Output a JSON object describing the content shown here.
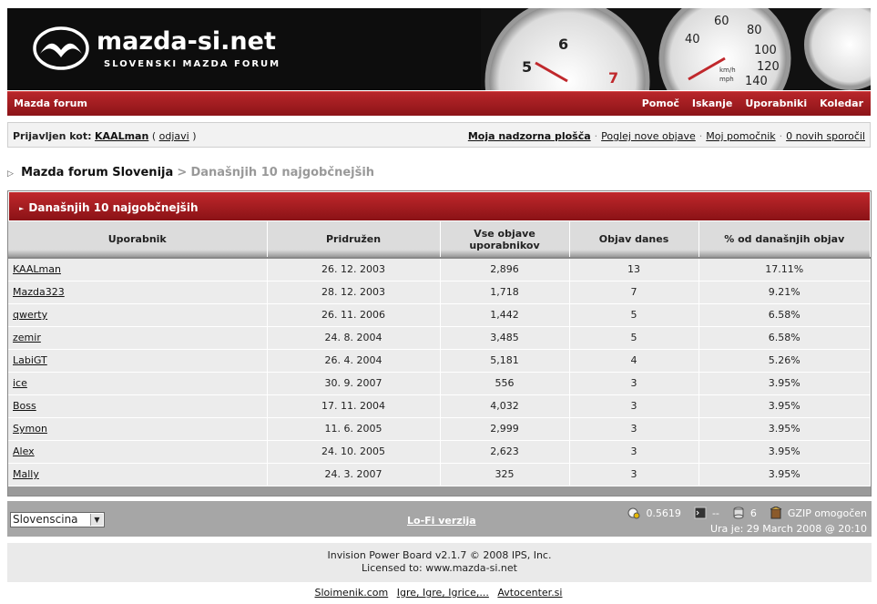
{
  "header": {
    "logo_text": "mazda-si.net",
    "logo_subtitle": "SLOVENSKI MAZDA FORUM",
    "logo_icon": "mazda-emblem-icon",
    "gauge_labels": [
      "5",
      "6",
      "7",
      "40",
      "60",
      "80",
      "100",
      "120",
      "140",
      "km/h",
      "mph"
    ]
  },
  "navbar": {
    "brand": "Mazda forum",
    "links": [
      "Pomoč",
      "Iskanje",
      "Uporabniki",
      "Koledar"
    ]
  },
  "userbar": {
    "logged_as_label": "Prijavljen kot:",
    "username": "KAALman",
    "logout_open": "(",
    "logout": "odjavi",
    "logout_close": ")",
    "links": [
      "Moja nadzorna plošča",
      "Poglej nove objave",
      "Moj pomočnik",
      "0 novih sporočil"
    ]
  },
  "breadcrumb": {
    "home": "Mazda forum Slovenija",
    "separator": ">",
    "current": "Današnjih 10 najgobčnejših"
  },
  "table": {
    "title": "Današnjih 10 najgobčnejših",
    "columns": [
      "Uporabnik",
      "Pridružen",
      "Vse objave uporabnikov",
      "Objav danes",
      "% od današnjih objav"
    ],
    "rows": [
      {
        "user": "KAALman",
        "joined": "26. 12. 2003",
        "total": "2,896",
        "today": "13",
        "pct": "17.11%"
      },
      {
        "user": "Mazda323",
        "joined": "28. 12. 2003",
        "total": "1,718",
        "today": "7",
        "pct": "9.21%"
      },
      {
        "user": "qwerty",
        "joined": "26. 11. 2006",
        "total": "1,442",
        "today": "5",
        "pct": "6.58%"
      },
      {
        "user": "zemir",
        "joined": "24. 8. 2004",
        "total": "3,485",
        "today": "5",
        "pct": "6.58%"
      },
      {
        "user": "LabiGT",
        "joined": "26. 4. 2004",
        "total": "5,181",
        "today": "4",
        "pct": "5.26%"
      },
      {
        "user": "ice",
        "joined": "30. 9. 2007",
        "total": "556",
        "today": "3",
        "pct": "3.95%"
      },
      {
        "user": "Boss",
        "joined": "17. 11. 2004",
        "total": "4,032",
        "today": "3",
        "pct": "3.95%"
      },
      {
        "user": "Symon",
        "joined": "11. 6. 2005",
        "total": "2,999",
        "today": "3",
        "pct": "3.95%"
      },
      {
        "user": "Alex",
        "joined": "24. 10. 2005",
        "total": "2,623",
        "today": "3",
        "pct": "3.95%"
      },
      {
        "user": "Mally",
        "joined": "24. 3. 2007",
        "total": "325",
        "today": "3",
        "pct": "3.95%"
      }
    ]
  },
  "footer": {
    "language": "Slovenscina",
    "lofi": "Lo-Fi verzija",
    "load": "0.5619",
    "server": "--",
    "queries": "6",
    "gzip": "GZIP omogočen",
    "time": "Ura je: 29 March 2008 @ 20:10"
  },
  "copyright": {
    "line1": "Invision Power Board v2.1.7 © 2008  IPS, Inc.",
    "line2": "Licensed to: www.mazda-si.net"
  },
  "bottom_links": [
    "Sloimenik.com",
    "Igre, Igre, Igrice,...",
    "Avtocenter.si"
  ]
}
